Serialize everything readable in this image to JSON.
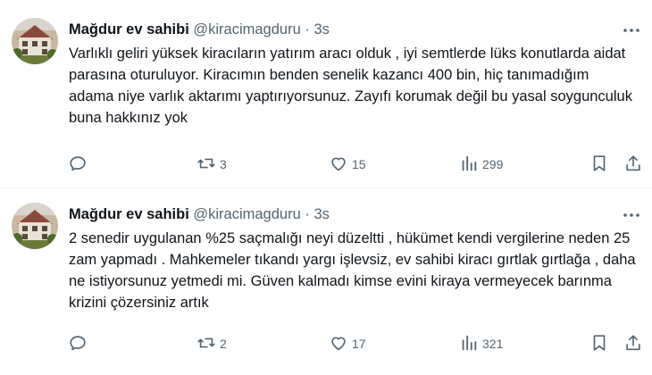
{
  "tweets": [
    {
      "author_name": "Mağdur ev sahibi",
      "handle": "@kiracimagduru",
      "separator": "·",
      "time": "3s",
      "text": "Varlıklı geliri yüksek kiracıların yatırım aracı olduk , iyi semtlerde lüks konutlarda aidat parasına oturuluyor. Kiracımın benden senelik kazancı 400 bin, hiç tanımadığım adama niye varlık aktarımı yaptırıyorsunuz. Zayıfı korumak değil bu yasal soygunculuk buna hakkınız yok",
      "reply_count": "",
      "retweet_count": "3",
      "like_count": "15",
      "view_count": "299",
      "icons": [
        "avatar",
        "more-icon",
        "reply-icon",
        "retweet-icon",
        "like-icon",
        "views-icon",
        "bookmark-icon",
        "share-icon"
      ]
    },
    {
      "author_name": "Mağdur ev sahibi",
      "handle": "@kiracimagduru",
      "separator": "·",
      "time": "3s",
      "text": "2 senedir uygulanan %25 saçmalığı neyi düzeltti , hükümet kendi vergilerine neden 25 zam yapmadı . Mahkemeler tıkandı yargı işlevsiz, ev sahibi kiracı gırtlak gırtlağa , daha ne istiyorsunuz yetmedi mi. Güven kalmadı kimse evini kiraya vermeyecek barınma krizini çözersiniz artık",
      "reply_count": "",
      "retweet_count": "2",
      "like_count": "17",
      "view_count": "321",
      "icons": [
        "avatar",
        "more-icon",
        "reply-icon",
        "retweet-icon",
        "like-icon",
        "views-icon",
        "bookmark-icon",
        "share-icon"
      ]
    }
  ],
  "colors": {
    "text_primary": "#0f1419",
    "text_secondary": "#536471",
    "divider": "#eff3f4",
    "background": "#ffffff"
  }
}
